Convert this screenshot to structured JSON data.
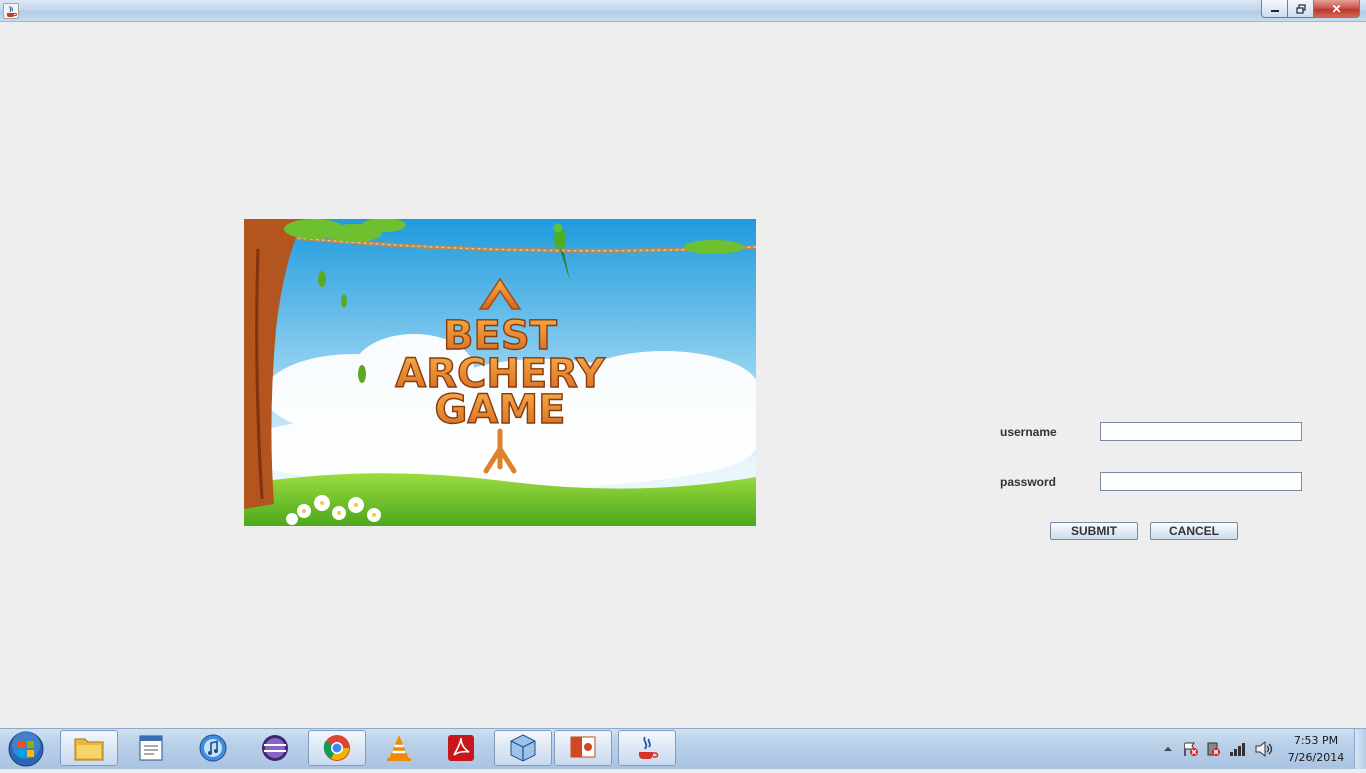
{
  "window": {
    "close_glyph": "✕"
  },
  "banner": {
    "line1": "BEST",
    "line2": "ARCHERY",
    "line3": "GAME"
  },
  "form": {
    "username_label": "username",
    "password_label": "password",
    "username_value": "",
    "password_value": "",
    "submit_label": "SUBMIT",
    "cancel_label": "CANCEL"
  },
  "taskbar": {
    "apps": [
      {
        "name": "windows-explorer-icon",
        "active": true
      },
      {
        "name": "notepad-icon",
        "active": false
      },
      {
        "name": "itunes-icon",
        "active": false
      },
      {
        "name": "eclipse-icon",
        "active": false
      },
      {
        "name": "chrome-icon",
        "active": true
      },
      {
        "name": "vlc-icon",
        "active": false
      },
      {
        "name": "acrobat-icon",
        "active": false
      },
      {
        "name": "virtualbox-icon",
        "active": true
      },
      {
        "name": "powerpoint-icon",
        "active": true
      },
      {
        "name": "java-icon",
        "active": true
      }
    ],
    "tray_icons": [
      "tray-expand-icon",
      "action-center-icon",
      "usb-icon",
      "network-signal-icon",
      "volume-icon"
    ],
    "clock_time": "7:53 PM",
    "clock_date": "7/26/2014"
  },
  "colors": {
    "desktop_bg": "#eeeeee",
    "banner_title_orange": "#e8892c",
    "sky_top": "#2ca6e0",
    "grass": "#74c32e"
  }
}
